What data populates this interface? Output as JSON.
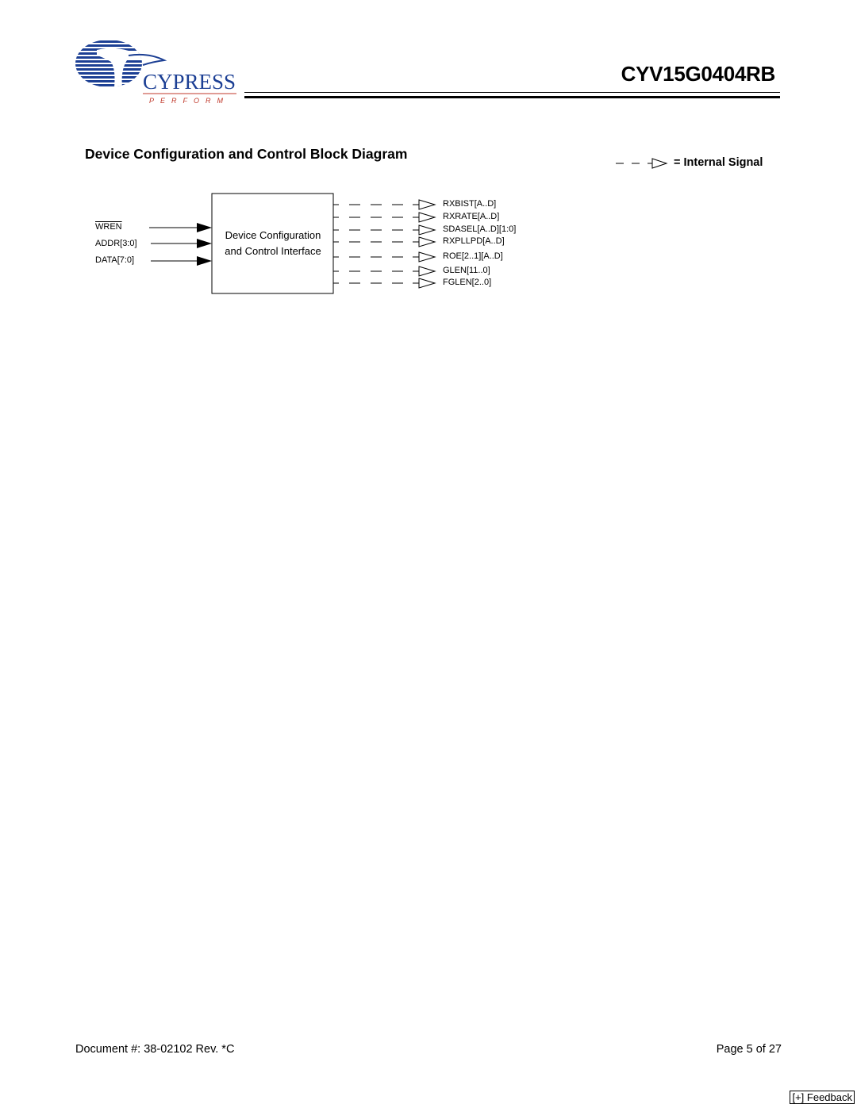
{
  "header": {
    "company": "CYPRESS",
    "tagline": "PERFORM",
    "part_number": "CYV15G0404RB"
  },
  "section": {
    "title": "Device Configuration and Control Block Diagram"
  },
  "legend": {
    "label": "= Internal Signal",
    "symbol": "dashed-arrow-icon"
  },
  "diagram": {
    "block_label_line1": "Device Configuration",
    "block_label_line2": "and Control Interface",
    "inputs": [
      {
        "label": "WREN",
        "overbar": true
      },
      {
        "label": "ADDR[3:0]",
        "overbar": false
      },
      {
        "label": "DATA[7:0]",
        "overbar": false
      }
    ],
    "outputs": [
      {
        "label": "RXBIST[A..D]"
      },
      {
        "label": "RXRATE[A..D]"
      },
      {
        "label": "SDASEL[A..D][1:0]"
      },
      {
        "label": "RXPLLPD[A..D]"
      },
      {
        "label": "ROE[2..1][A..D]"
      },
      {
        "label": "GLEN[11..0]"
      },
      {
        "label": "FGLEN[2..0]"
      }
    ]
  },
  "footer": {
    "document": "Document #: 38-02102 Rev. *C",
    "page": "Page 5 of 27",
    "feedback": "[+] Feedback"
  },
  "colors": {
    "logo_blue": "#1c3f94",
    "tagline_red": "#c0392b"
  }
}
